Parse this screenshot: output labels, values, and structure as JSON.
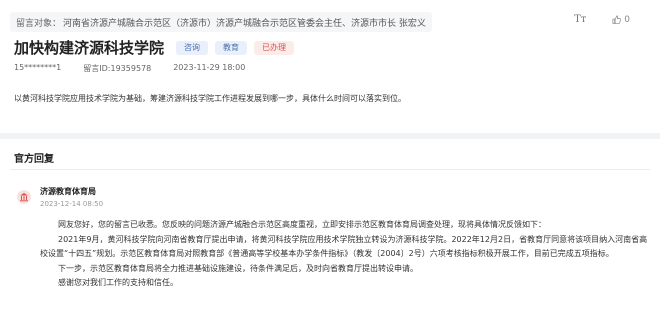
{
  "target": {
    "label": "留言对象：",
    "value": "河南省济源产城融合示范区（济源市）济源产城融合示范区管委会主任、济源市市长 张宏义"
  },
  "tools": {
    "fontsize_icon": "fontsize-icon",
    "fontsize_glyph": "Tт",
    "like_count": "0"
  },
  "message": {
    "title": "加快构建济源科技学院",
    "tags": [
      {
        "label": "咨询",
        "color": "#4a6fb0"
      },
      {
        "label": "教育",
        "color": "#4a6fb0"
      },
      {
        "label": "已办理",
        "color": "#d9534f"
      }
    ],
    "user": "15********1",
    "id": "留言ID:19359578",
    "date": "2023-11-29 18:00",
    "content": "以黄河科技学院应用技术学院为基础，筹建济源科技学院工作进程发展到哪一步，具体什么时间可以落实到位。"
  },
  "reply": {
    "section_title": "官方回复",
    "org": "济源教育体育局",
    "time": "2023-12-14 08:50",
    "paragraphs": [
      "网友您好，您的留言已收悉。您反映的问题济源产城融合示范区高度重视，立即安排示范区教育体育局调查处理，现将具体情况反馈如下：",
      "2021年9月，黄河科技学院向河南省教育厅提出申请，将黄河科技学院应用技术学院独立转设为济源科技学院。2022年12月2日，省教育厅同意将该项目纳入河南省高校设置“十四五”规划。示范区教育体育局对照教育部《普通高等学校基本办学条件指标》（教发〔2004〕2号）六项考核指标积极开展工作，目前已完成五项指标。",
      "下一步，示范区教育体育局将全力推进基础设施建设，待条件满足后，及时向省教育厅提出转设申请。",
      "感谢您对我们工作的支持和信任。"
    ]
  }
}
